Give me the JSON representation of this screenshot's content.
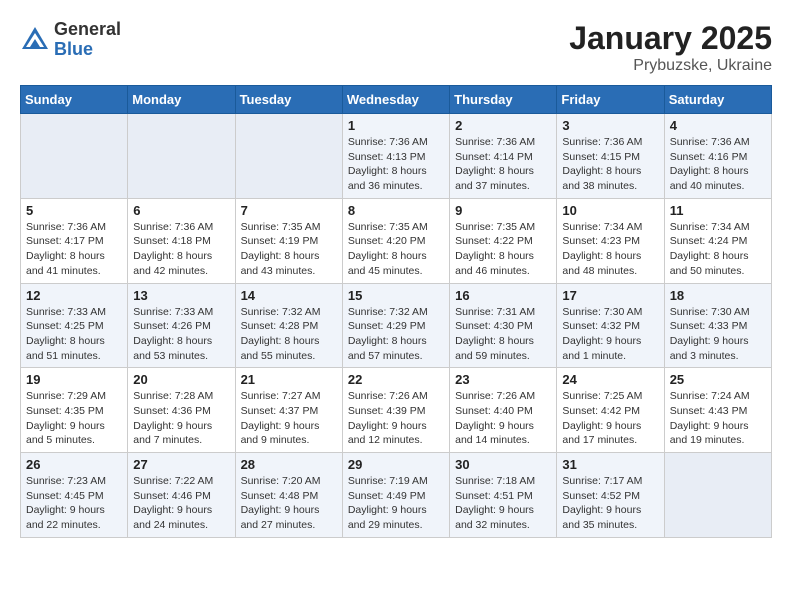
{
  "header": {
    "logo_general": "General",
    "logo_blue": "Blue",
    "month": "January 2025",
    "location": "Prybuzske, Ukraine"
  },
  "weekdays": [
    "Sunday",
    "Monday",
    "Tuesday",
    "Wednesday",
    "Thursday",
    "Friday",
    "Saturday"
  ],
  "weeks": [
    [
      {
        "day": "",
        "info": ""
      },
      {
        "day": "",
        "info": ""
      },
      {
        "day": "",
        "info": ""
      },
      {
        "day": "1",
        "info": "Sunrise: 7:36 AM\nSunset: 4:13 PM\nDaylight: 8 hours and 36 minutes."
      },
      {
        "day": "2",
        "info": "Sunrise: 7:36 AM\nSunset: 4:14 PM\nDaylight: 8 hours and 37 minutes."
      },
      {
        "day": "3",
        "info": "Sunrise: 7:36 AM\nSunset: 4:15 PM\nDaylight: 8 hours and 38 minutes."
      },
      {
        "day": "4",
        "info": "Sunrise: 7:36 AM\nSunset: 4:16 PM\nDaylight: 8 hours and 40 minutes."
      }
    ],
    [
      {
        "day": "5",
        "info": "Sunrise: 7:36 AM\nSunset: 4:17 PM\nDaylight: 8 hours and 41 minutes."
      },
      {
        "day": "6",
        "info": "Sunrise: 7:36 AM\nSunset: 4:18 PM\nDaylight: 8 hours and 42 minutes."
      },
      {
        "day": "7",
        "info": "Sunrise: 7:35 AM\nSunset: 4:19 PM\nDaylight: 8 hours and 43 minutes."
      },
      {
        "day": "8",
        "info": "Sunrise: 7:35 AM\nSunset: 4:20 PM\nDaylight: 8 hours and 45 minutes."
      },
      {
        "day": "9",
        "info": "Sunrise: 7:35 AM\nSunset: 4:22 PM\nDaylight: 8 hours and 46 minutes."
      },
      {
        "day": "10",
        "info": "Sunrise: 7:34 AM\nSunset: 4:23 PM\nDaylight: 8 hours and 48 minutes."
      },
      {
        "day": "11",
        "info": "Sunrise: 7:34 AM\nSunset: 4:24 PM\nDaylight: 8 hours and 50 minutes."
      }
    ],
    [
      {
        "day": "12",
        "info": "Sunrise: 7:33 AM\nSunset: 4:25 PM\nDaylight: 8 hours and 51 minutes."
      },
      {
        "day": "13",
        "info": "Sunrise: 7:33 AM\nSunset: 4:26 PM\nDaylight: 8 hours and 53 minutes."
      },
      {
        "day": "14",
        "info": "Sunrise: 7:32 AM\nSunset: 4:28 PM\nDaylight: 8 hours and 55 minutes."
      },
      {
        "day": "15",
        "info": "Sunrise: 7:32 AM\nSunset: 4:29 PM\nDaylight: 8 hours and 57 minutes."
      },
      {
        "day": "16",
        "info": "Sunrise: 7:31 AM\nSunset: 4:30 PM\nDaylight: 8 hours and 59 minutes."
      },
      {
        "day": "17",
        "info": "Sunrise: 7:30 AM\nSunset: 4:32 PM\nDaylight: 9 hours and 1 minute."
      },
      {
        "day": "18",
        "info": "Sunrise: 7:30 AM\nSunset: 4:33 PM\nDaylight: 9 hours and 3 minutes."
      }
    ],
    [
      {
        "day": "19",
        "info": "Sunrise: 7:29 AM\nSunset: 4:35 PM\nDaylight: 9 hours and 5 minutes."
      },
      {
        "day": "20",
        "info": "Sunrise: 7:28 AM\nSunset: 4:36 PM\nDaylight: 9 hours and 7 minutes."
      },
      {
        "day": "21",
        "info": "Sunrise: 7:27 AM\nSunset: 4:37 PM\nDaylight: 9 hours and 9 minutes."
      },
      {
        "day": "22",
        "info": "Sunrise: 7:26 AM\nSunset: 4:39 PM\nDaylight: 9 hours and 12 minutes."
      },
      {
        "day": "23",
        "info": "Sunrise: 7:26 AM\nSunset: 4:40 PM\nDaylight: 9 hours and 14 minutes."
      },
      {
        "day": "24",
        "info": "Sunrise: 7:25 AM\nSunset: 4:42 PM\nDaylight: 9 hours and 17 minutes."
      },
      {
        "day": "25",
        "info": "Sunrise: 7:24 AM\nSunset: 4:43 PM\nDaylight: 9 hours and 19 minutes."
      }
    ],
    [
      {
        "day": "26",
        "info": "Sunrise: 7:23 AM\nSunset: 4:45 PM\nDaylight: 9 hours and 22 minutes."
      },
      {
        "day": "27",
        "info": "Sunrise: 7:22 AM\nSunset: 4:46 PM\nDaylight: 9 hours and 24 minutes."
      },
      {
        "day": "28",
        "info": "Sunrise: 7:20 AM\nSunset: 4:48 PM\nDaylight: 9 hours and 27 minutes."
      },
      {
        "day": "29",
        "info": "Sunrise: 7:19 AM\nSunset: 4:49 PM\nDaylight: 9 hours and 29 minutes."
      },
      {
        "day": "30",
        "info": "Sunrise: 7:18 AM\nSunset: 4:51 PM\nDaylight: 9 hours and 32 minutes."
      },
      {
        "day": "31",
        "info": "Sunrise: 7:17 AM\nSunset: 4:52 PM\nDaylight: 9 hours and 35 minutes."
      },
      {
        "day": "",
        "info": ""
      }
    ]
  ]
}
